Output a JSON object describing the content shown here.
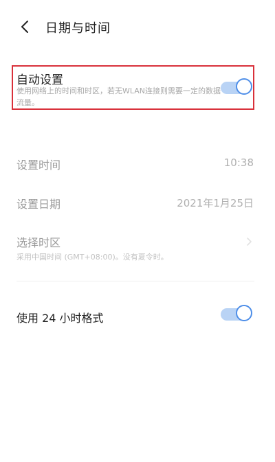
{
  "header": {
    "title": "日期与时间",
    "back_icon": "chevron-left-icon"
  },
  "auto_setting": {
    "label": "自动设置",
    "description": "使用网络上的时间和时区，若无WLAN连接则需要一定的数据流量。",
    "enabled": true,
    "highlight_color": "#d9303a"
  },
  "set_time": {
    "label": "设置时间",
    "value": "10:38"
  },
  "set_date": {
    "label": "设置日期",
    "value": "2021年1月25日"
  },
  "timezone": {
    "label": "选择时区",
    "description": "采用中国时间 (GMT+08:00)。没有夏令时。",
    "icon": "chevron-right-icon"
  },
  "format24": {
    "label": "使用 24 小时格式",
    "enabled": true
  },
  "colors": {
    "accent": "#4e8ee8",
    "accent_track": "#b9d3f5",
    "disabled_text": "#9a9a9a"
  }
}
